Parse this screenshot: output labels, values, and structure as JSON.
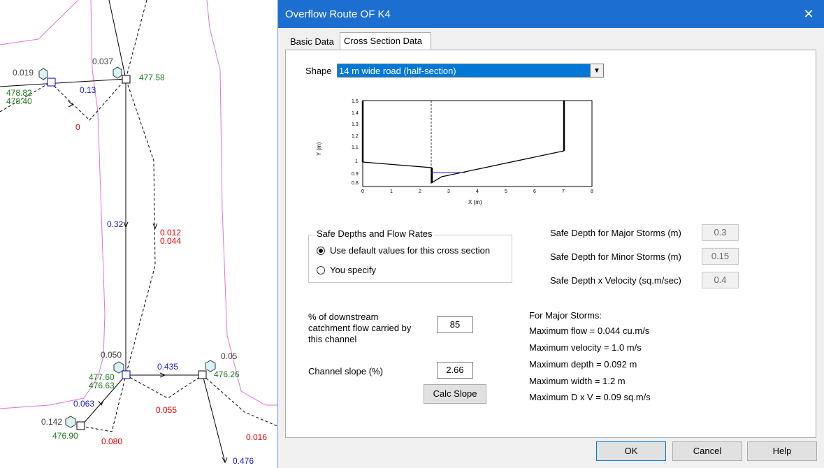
{
  "map": {
    "labels": [
      {
        "id": "n1-depth",
        "text": "0.019",
        "color": "#404040"
      },
      {
        "id": "n2-depth",
        "text": "0.037",
        "color": "#404040"
      },
      {
        "id": "n1-lev1",
        "text": "478.82",
        "color": "#1e7a1e"
      },
      {
        "id": "n1-lev2",
        "text": "478.40",
        "color": "#1e7a1e"
      },
      {
        "id": "pipe1-flow",
        "text": "0.13",
        "color": "#1a1ad0"
      },
      {
        "id": "n2-level",
        "text": "477.58",
        "color": "#1e7a1e"
      },
      {
        "id": "route-zero",
        "text": "0",
        "color": "#e00000"
      },
      {
        "id": "pipe2-flow",
        "text": "0.32",
        "color": "#1a1ad0"
      },
      {
        "id": "route2-f1",
        "text": "0.012",
        "color": "#e00000"
      },
      {
        "id": "route2-f2",
        "text": "0.044",
        "color": "#e00000"
      },
      {
        "id": "n3-depth",
        "text": "0.050",
        "color": "#404040"
      },
      {
        "id": "pipe3-flow",
        "text": "0.435",
        "color": "#1a1ad0"
      },
      {
        "id": "n4-depth",
        "text": "0.05",
        "color": "#404040"
      },
      {
        "id": "n3-lev1",
        "text": "477.60",
        "color": "#1e7a1e"
      },
      {
        "id": "n3-lev2",
        "text": "476.63",
        "color": "#1e7a1e"
      },
      {
        "id": "n4-level",
        "text": "476.26",
        "color": "#1e7a1e"
      },
      {
        "id": "pipe4-flow",
        "text": "0.063",
        "color": "#1a1ad0"
      },
      {
        "id": "route3-flow",
        "text": "0.055",
        "color": "#e00000"
      },
      {
        "id": "n5-depth",
        "text": "0.142",
        "color": "#404040"
      },
      {
        "id": "n5-level",
        "text": "476.90",
        "color": "#1e7a1e"
      },
      {
        "id": "route4-flow",
        "text": "0.080",
        "color": "#e00000"
      },
      {
        "id": "route5-flow",
        "text": "0.016",
        "color": "#e00000"
      },
      {
        "id": "pipe5-flow",
        "text": "0.476",
        "color": "#1a1ad0"
      }
    ]
  },
  "dialog": {
    "title": "Overflow Route OF K4",
    "close_glyph": "✕",
    "tabs": [
      "Basic Data",
      "Cross Section Data"
    ],
    "shape_label": "Shape",
    "shape_value": "14 m wide road (half-section)",
    "plot": {
      "ylabel": "Y (m)",
      "xlabel": "X (m)",
      "yticks": [
        "1.5",
        "1.4",
        "1.3",
        "1.2",
        "1.1",
        "1",
        "0.9",
        "0.8"
      ],
      "xticks": [
        "0",
        "1",
        "2",
        "3",
        "4",
        "5",
        "6",
        "7",
        "8"
      ]
    },
    "group": {
      "title": "Safe Depths and Flow Rates",
      "option_default": "Use default values for this cross section",
      "option_specify": "You specify",
      "selected": "default"
    },
    "safe": {
      "major_label": "Safe Depth for Major Storms (m)",
      "major_value": "0.3",
      "minor_label": "Safe Depth for Minor Storms (m)",
      "minor_value": "0.15",
      "dxv_label": "Safe Depth x Velocity (sq.m/sec)",
      "dxv_value": "0.4"
    },
    "pct_label_1": "% of downstream",
    "pct_label_2": "catchment flow carried by",
    "pct_label_3": "this channel",
    "pct_value": "85",
    "slope_label": "Channel slope (%)",
    "slope_value": "2.66",
    "calc_slope": "Calc Slope",
    "results": {
      "heading": "For Major Storms:",
      "max_flow": "Maximum flow = 0.044 cu.m/s",
      "max_velocity": "Maximum velocity = 1.0 m/s",
      "max_depth": "Maximum depth = 0.092 m",
      "max_width": "Maximum width = 1.2 m",
      "max_dxv": "Maximum D x V = 0.09 sq.m/s"
    },
    "buttons": {
      "ok": "OK",
      "cancel": "Cancel",
      "help": "Help"
    }
  }
}
